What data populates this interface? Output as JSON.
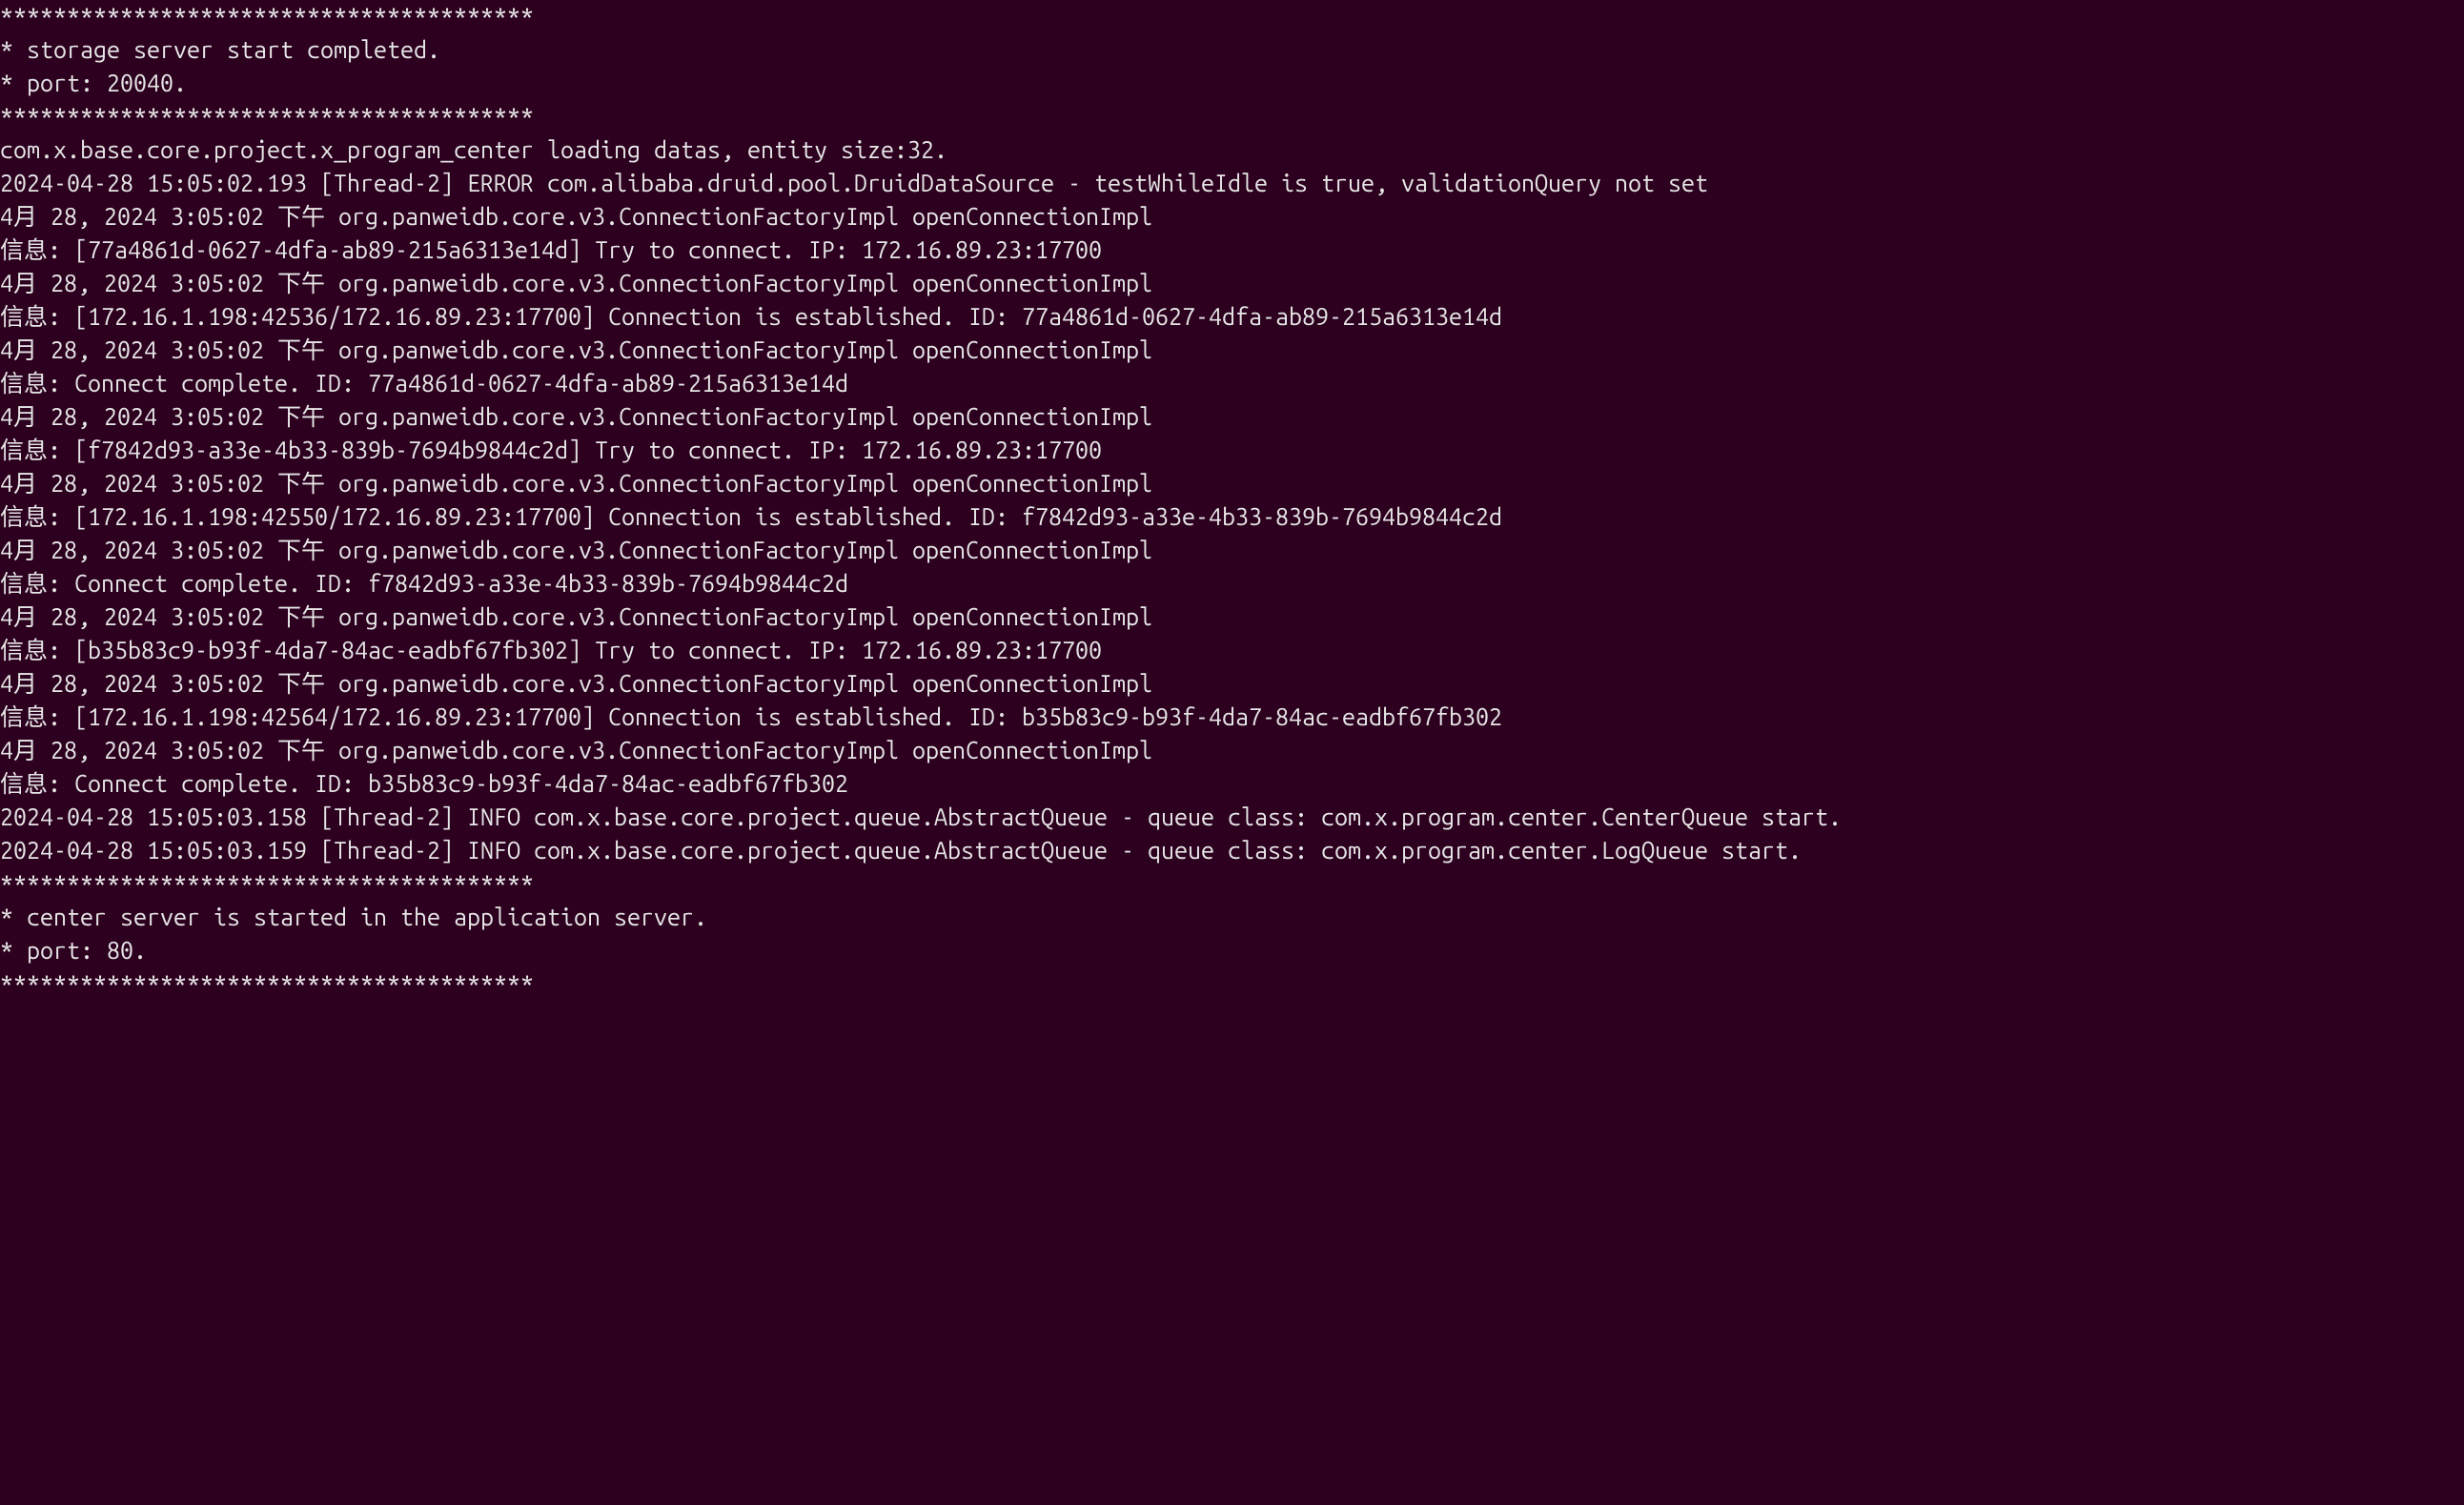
{
  "terminal": {
    "lines": [
      "****************************************",
      "* storage server start completed.",
      "* port: 20040.",
      "****************************************",
      "com.x.base.core.project.x_program_center loading datas, entity size:32.",
      "2024-04-28 15:05:02.193 [Thread-2] ERROR com.alibaba.druid.pool.DruidDataSource - testWhileIdle is true, validationQuery not set",
      "4月 28, 2024 3:05:02 下午 org.panweidb.core.v3.ConnectionFactoryImpl openConnectionImpl",
      "信息: [77a4861d-0627-4dfa-ab89-215a6313e14d] Try to connect. IP: 172.16.89.23:17700",
      "4月 28, 2024 3:05:02 下午 org.panweidb.core.v3.ConnectionFactoryImpl openConnectionImpl",
      "信息: [172.16.1.198:42536/172.16.89.23:17700] Connection is established. ID: 77a4861d-0627-4dfa-ab89-215a6313e14d",
      "4月 28, 2024 3:05:02 下午 org.panweidb.core.v3.ConnectionFactoryImpl openConnectionImpl",
      "信息: Connect complete. ID: 77a4861d-0627-4dfa-ab89-215a6313e14d",
      "4月 28, 2024 3:05:02 下午 org.panweidb.core.v3.ConnectionFactoryImpl openConnectionImpl",
      "信息: [f7842d93-a33e-4b33-839b-7694b9844c2d] Try to connect. IP: 172.16.89.23:17700",
      "4月 28, 2024 3:05:02 下午 org.panweidb.core.v3.ConnectionFactoryImpl openConnectionImpl",
      "信息: [172.16.1.198:42550/172.16.89.23:17700] Connection is established. ID: f7842d93-a33e-4b33-839b-7694b9844c2d",
      "4月 28, 2024 3:05:02 下午 org.panweidb.core.v3.ConnectionFactoryImpl openConnectionImpl",
      "信息: Connect complete. ID: f7842d93-a33e-4b33-839b-7694b9844c2d",
      "4月 28, 2024 3:05:02 下午 org.panweidb.core.v3.ConnectionFactoryImpl openConnectionImpl",
      "信息: [b35b83c9-b93f-4da7-84ac-eadbf67fb302] Try to connect. IP: 172.16.89.23:17700",
      "4月 28, 2024 3:05:02 下午 org.panweidb.core.v3.ConnectionFactoryImpl openConnectionImpl",
      "信息: [172.16.1.198:42564/172.16.89.23:17700] Connection is established. ID: b35b83c9-b93f-4da7-84ac-eadbf67fb302",
      "4月 28, 2024 3:05:02 下午 org.panweidb.core.v3.ConnectionFactoryImpl openConnectionImpl",
      "信息: Connect complete. ID: b35b83c9-b93f-4da7-84ac-eadbf67fb302",
      "2024-04-28 15:05:03.158 [Thread-2] INFO com.x.base.core.project.queue.AbstractQueue - queue class: com.x.program.center.CenterQueue start.",
      "2024-04-28 15:05:03.159 [Thread-2] INFO com.x.base.core.project.queue.AbstractQueue - queue class: com.x.program.center.LogQueue start.",
      "****************************************",
      "* center server is started in the application server.",
      "* port: 80.",
      "****************************************"
    ]
  }
}
